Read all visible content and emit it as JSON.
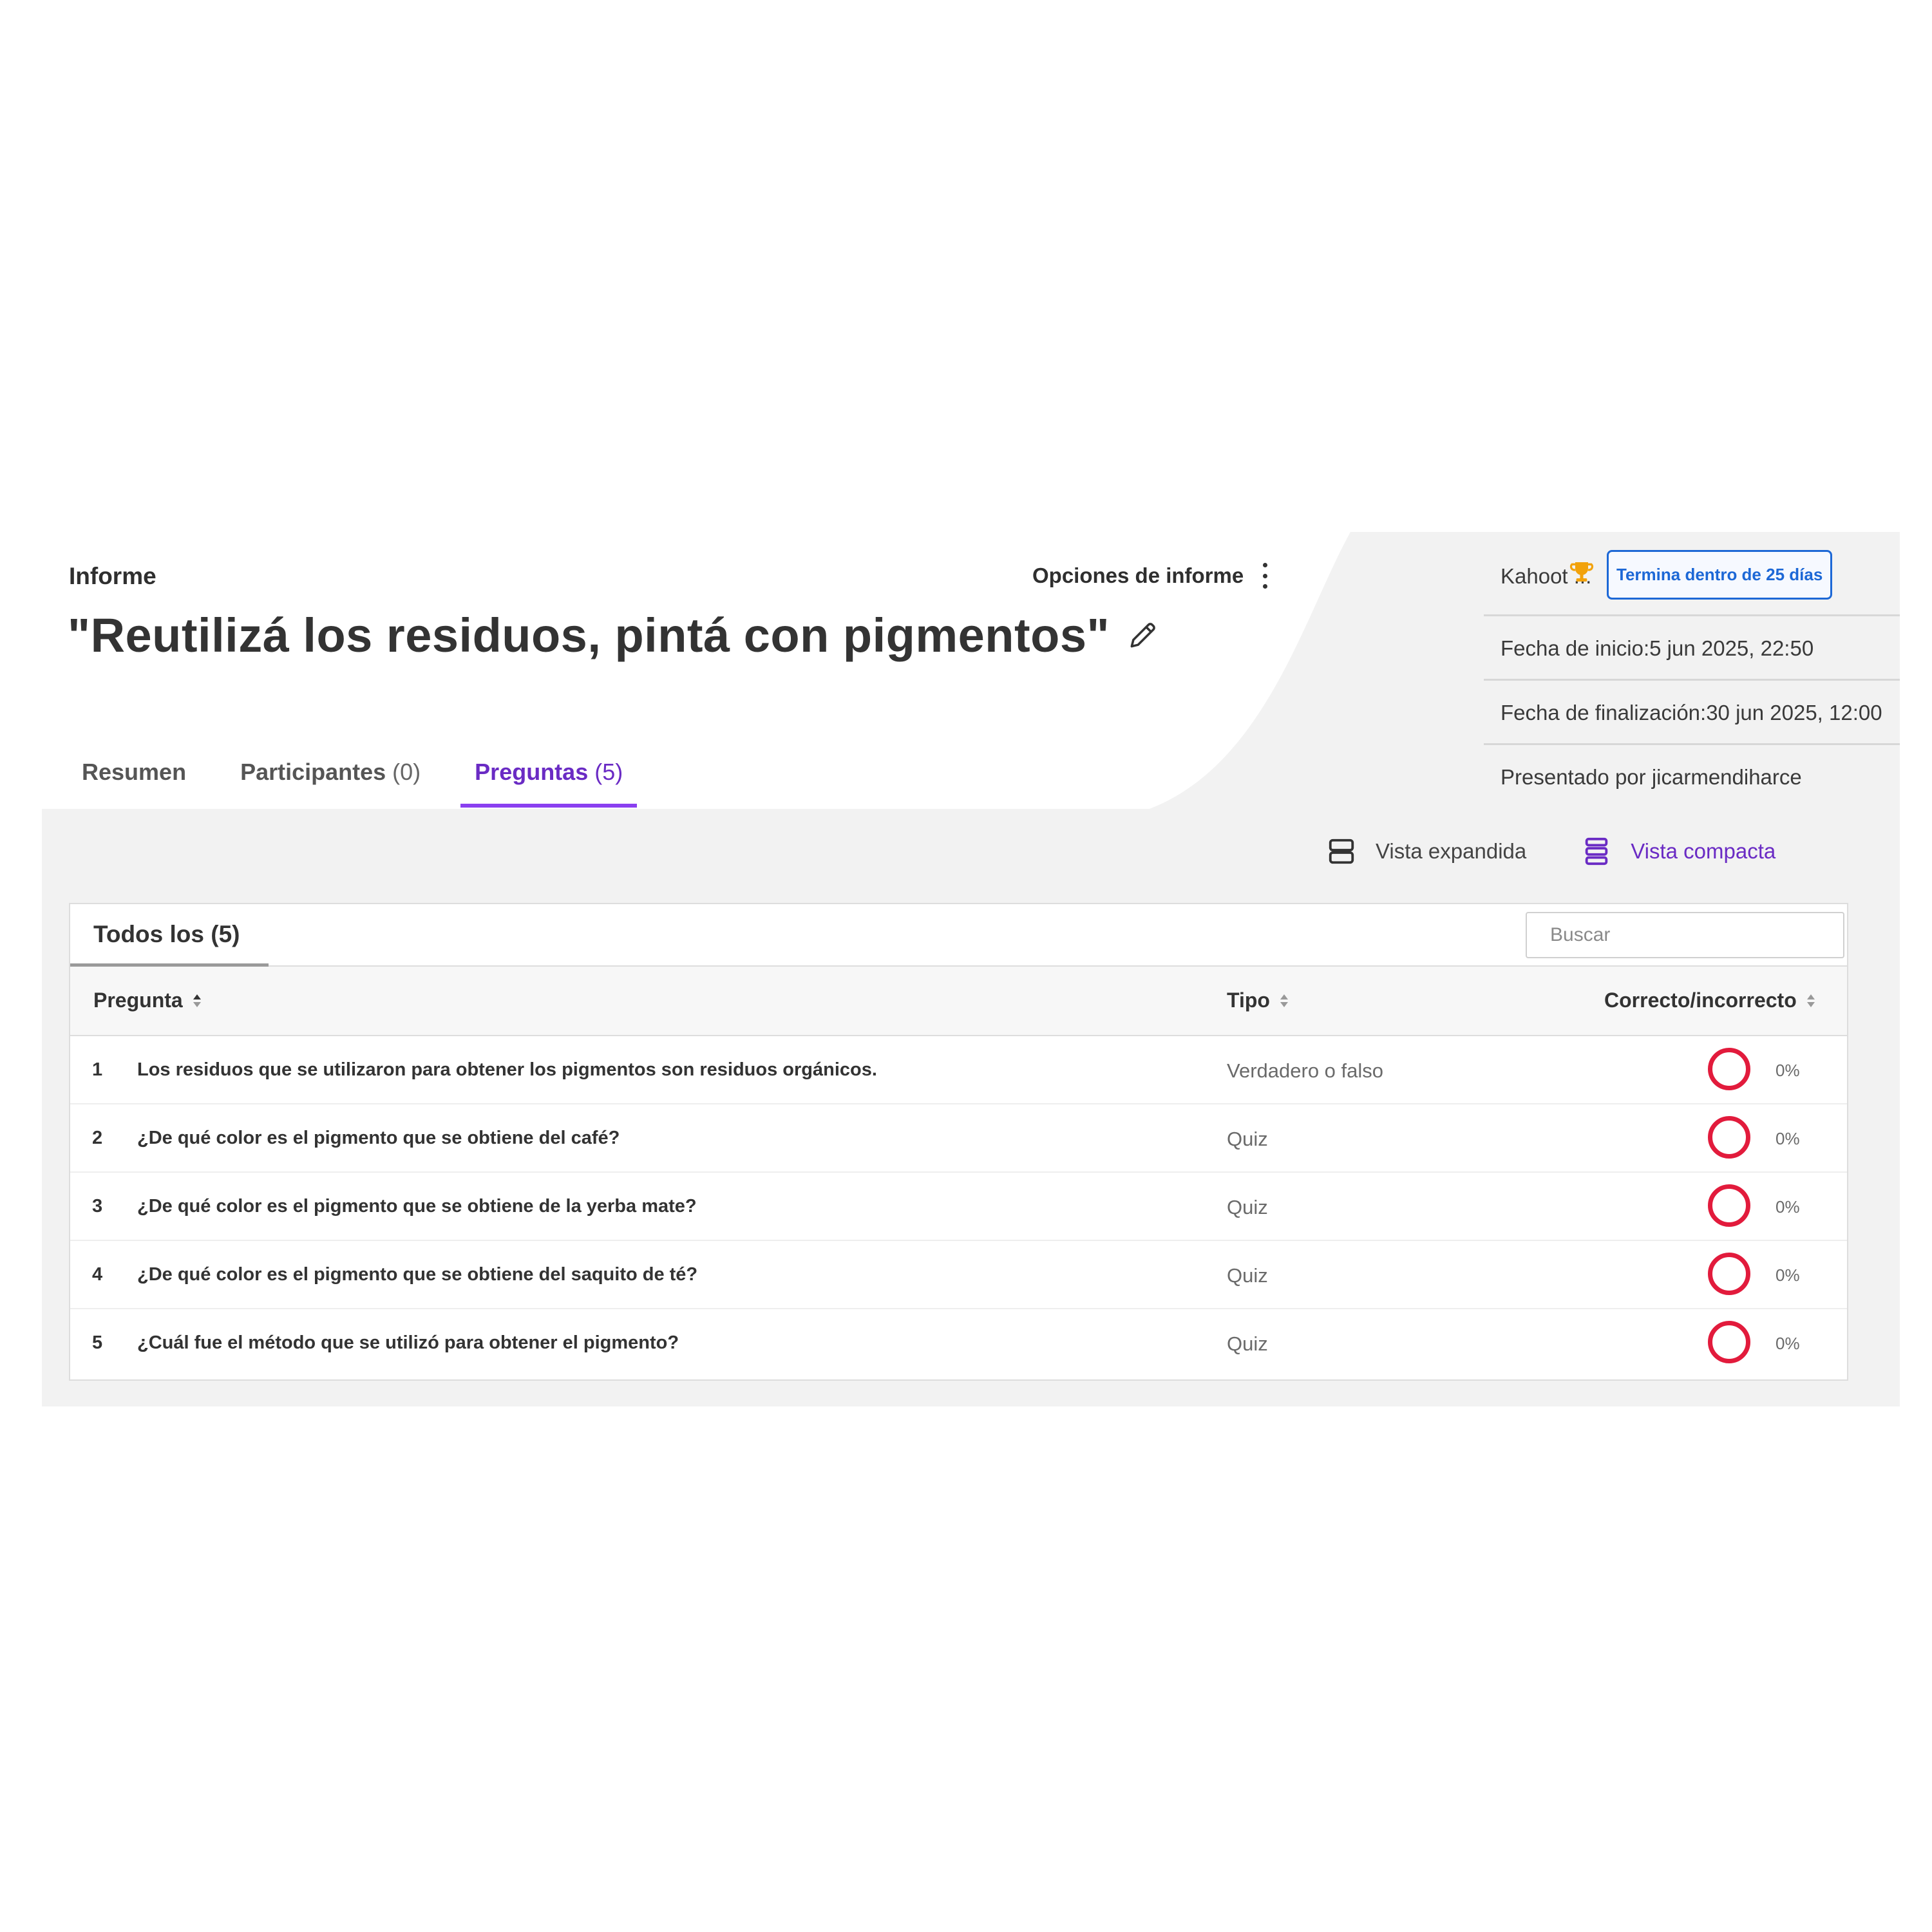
{
  "header": {
    "section_label": "Informe",
    "options_label": "Opciones de informe",
    "title": "\"Reutilizá los residuos, pintá con pigmentos\""
  },
  "tabs": [
    {
      "label": "Resumen",
      "count": ""
    },
    {
      "label": "Participantes",
      "count": "(0)"
    },
    {
      "label": "Preguntas",
      "count": "(5)",
      "active": true
    }
  ],
  "meta": {
    "kahoot_label": "Kahoot ...",
    "badge": "Termina dentro de 25 días",
    "start": "Fecha de inicio:5 jun 2025, 22:50",
    "end": "Fecha de finalización:30 jun 2025, 12:00",
    "host": "Presentado por jicarmendiharce"
  },
  "views": {
    "expanded": "Vista expandida",
    "compact": "Vista compacta",
    "active": "compact"
  },
  "filter": {
    "label": "Todos los (5)",
    "search_placeholder": "Buscar"
  },
  "table": {
    "columns": [
      "Pregunta",
      "Tipo",
      "Correcto/incorrecto"
    ],
    "rows": [
      {
        "n": "1",
        "question": "Los residuos que se utilizaron para obtener los pigmentos son residuos orgánicos.",
        "type": "Verdadero o falso",
        "correct": "0%"
      },
      {
        "n": "2",
        "question": "¿De qué color es el pigmento que se obtiene del café?",
        "type": "Quiz",
        "correct": "0%"
      },
      {
        "n": "3",
        "question": "¿De qué color es el pigmento que se obtiene de la yerba mate?",
        "type": "Quiz",
        "correct": "0%"
      },
      {
        "n": "4",
        "question": "¿De qué color es el pigmento que se obtiene del saquito de té?",
        "type": "Quiz",
        "correct": "0%"
      },
      {
        "n": "5",
        "question": "¿Cuál fue el método que se utilizó para obtener el pigmento?",
        "type": "Quiz",
        "correct": "0%"
      }
    ]
  },
  "colors": {
    "accent": "#6a2bc4",
    "badge": "#1d68d6",
    "incorrect_ring": "#e21b3c",
    "trophy": "#f2a20b"
  }
}
